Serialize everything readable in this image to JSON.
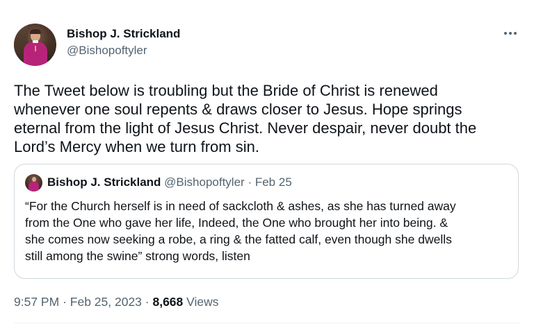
{
  "author": {
    "name": "Bishop J. Strickland",
    "handle": "@Bishopoftyler"
  },
  "tweet": {
    "text": "The Tweet below is troubling but the Bride of Christ is renewed\nwhenever one soul repents & draws closer to Jesus. Hope springs\neternal from the light of Jesus Christ. Never despair, never doubt the\nLord’s Mercy when we turn from sin.",
    "time": "9:57 PM",
    "date": "Feb 25, 2023",
    "views_count": "8,668",
    "views_label": "Views",
    "separator": "·"
  },
  "quoted_tweet": {
    "name": "Bishop J. Strickland",
    "handle": "@Bishopoftyler",
    "date": "Feb 25",
    "separator": "·",
    "text": "“For the Church herself is in need of sackcloth & ashes, as she has turned away\nfrom the One who gave her life, Indeed, the One who brought her into being. &\nshe comes now seeking a robe, a ring & the fatted calf, even though she dwells\nstill among the swine” strong words, listen"
  },
  "icons": {
    "more": "more-options-icon"
  },
  "colors": {
    "text": "#0f1419",
    "secondary": "#536471",
    "border": "#cfd9de"
  }
}
